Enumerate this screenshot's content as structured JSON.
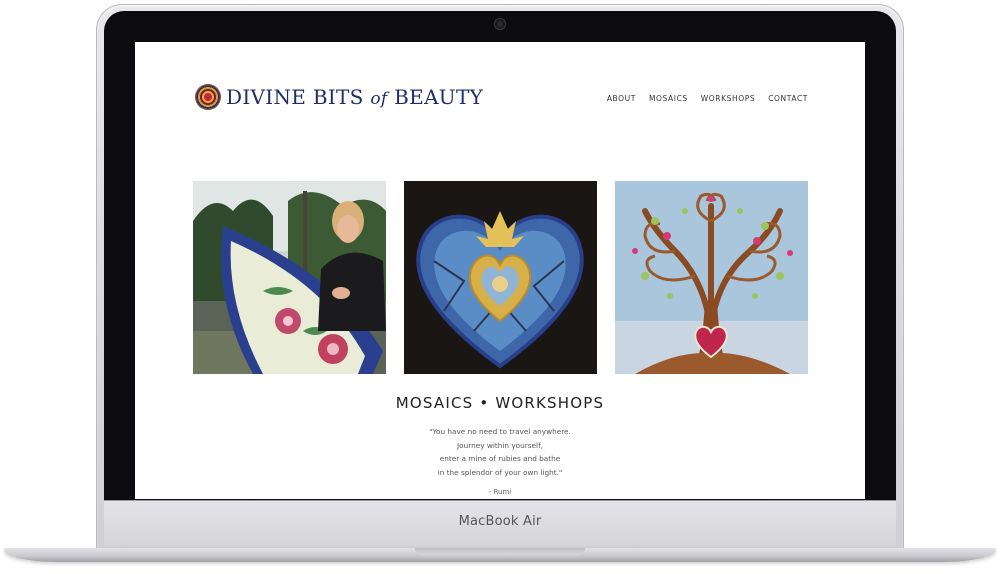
{
  "device": {
    "brand_label": "MacBook Air"
  },
  "site": {
    "logo": {
      "part1": "DIVINE BITS",
      "part2": "of",
      "part3": "BEAUTY"
    },
    "nav": [
      {
        "label": "ABOUT"
      },
      {
        "label": "MOSAICS"
      },
      {
        "label": "WORKSHOPS"
      },
      {
        "label": "CONTACT"
      }
    ],
    "gallery": [
      {
        "name": "artist-with-mosaic-surfboard"
      },
      {
        "name": "mosaic-sacred-heart"
      },
      {
        "name": "mosaic-tree-of-life"
      }
    ],
    "heading": "MOSAICS •  WORKSHOPS",
    "quote": {
      "lines": [
        "\"You have no need to travel anywhere.",
        "Journey within yourself,",
        "enter a mine of rubies and bathe",
        "in the splendor of your own light.\""
      ],
      "attribution": "- Rumi"
    }
  },
  "colors": {
    "logo": "#1f2d6e",
    "frame": "#d9d9dd",
    "bezel": "#0c0c0e"
  }
}
